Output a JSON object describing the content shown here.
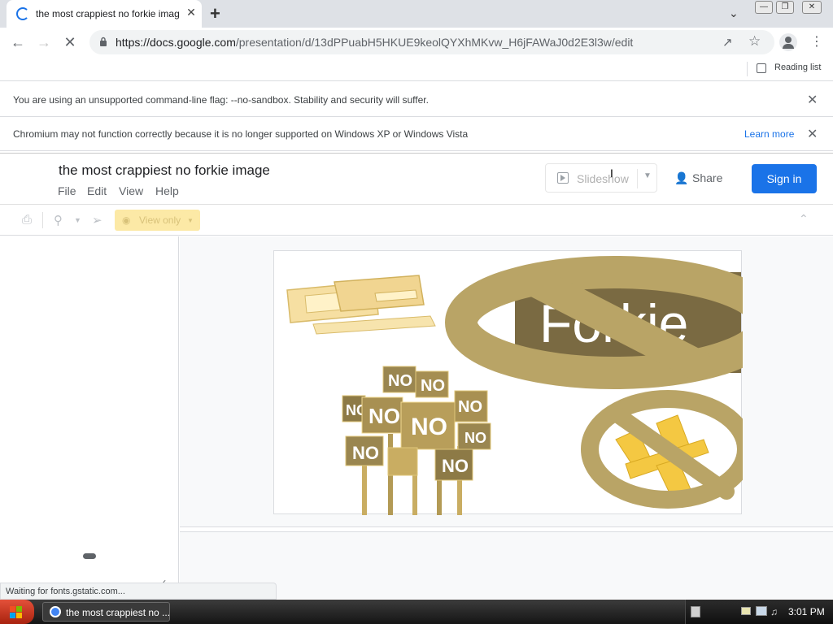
{
  "browser": {
    "tab": {
      "title": "the most crappiest no forkie image",
      "close": "✕"
    },
    "new_tab": "+",
    "url_host": "https://docs.google.com",
    "url_path": "/presentation/d/13dPPuabH5HKUE9keolQYXhMKvw_H6jFAWaJ0d2E3l3w/edit",
    "reading_list": "Reading list"
  },
  "infobars": [
    {
      "message": "You are using an unsupported command-line flag: --no-sandbox. Stability and security will suffer."
    },
    {
      "message": "Chromium may not function correctly because it is no longer supported on Windows XP or Windows Vista",
      "link": "Learn more"
    }
  ],
  "docs": {
    "title": "the most crappiest no forkie image",
    "menus": [
      "File",
      "Edit",
      "View",
      "Help"
    ],
    "slideshow": "Slideshow",
    "share": "Share",
    "sign_in": "Sign in",
    "view_only": "View only"
  },
  "slide": {
    "forkie_text": "Forkie",
    "sign_text": "NO"
  },
  "status": "Waiting for fonts.gstatic.com...",
  "taskbar": {
    "task_label": "the most crappiest no ...",
    "clock": "3:01 PM"
  },
  "colors": {
    "accent": "#1a73e8",
    "gold": "#b9a466",
    "dark_gold": "#7a6a42",
    "view_only_bg": "#fce9a6"
  }
}
